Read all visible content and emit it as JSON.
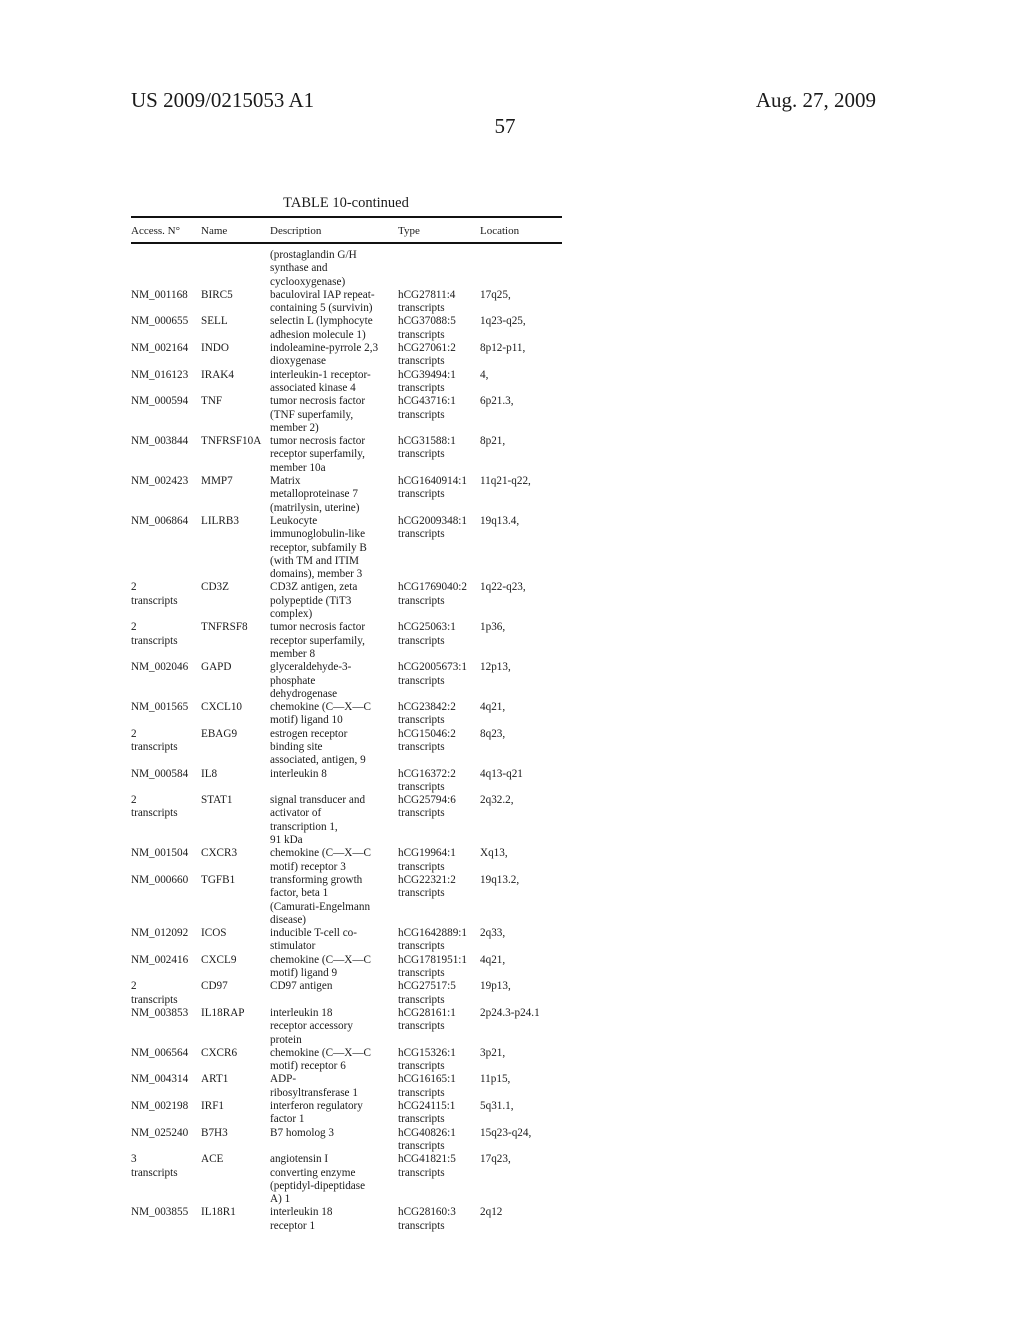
{
  "header": {
    "publication_number": "US 2009/0215053 A1",
    "date": "Aug. 27, 2009",
    "page_number": "57"
  },
  "table": {
    "title": "TABLE 10-continued",
    "columns": [
      "Access. N°",
      "Name",
      "Description",
      "Type",
      "Location"
    ],
    "rows": [
      {
        "access": [
          ""
        ],
        "name": [
          ""
        ],
        "description": [
          "(prostaglandin G/H",
          "synthase and",
          "cyclooxygenase)"
        ],
        "type": [
          ""
        ],
        "location": [
          ""
        ]
      },
      {
        "access": [
          "NM_001168"
        ],
        "name": [
          "BIRC5"
        ],
        "description": [
          "baculoviral IAP repeat-",
          "containing 5 (survivin)"
        ],
        "type": [
          "hCG27811:4",
          "transcripts"
        ],
        "location": [
          "17q25,"
        ]
      },
      {
        "access": [
          "NM_000655"
        ],
        "name": [
          "SELL"
        ],
        "description": [
          "selectin L (lymphocyte",
          "adhesion molecule 1)"
        ],
        "type": [
          "hCG37088:5",
          "transcripts"
        ],
        "location": [
          "1q23-q25,"
        ]
      },
      {
        "access": [
          "NM_002164"
        ],
        "name": [
          "INDO"
        ],
        "description": [
          "indoleamine-pyrrole 2,3",
          "dioxygenase"
        ],
        "type": [
          "hCG27061:2",
          "transcripts"
        ],
        "location": [
          "8p12-p11,"
        ]
      },
      {
        "access": [
          "NM_016123"
        ],
        "name": [
          "IRAK4"
        ],
        "description": [
          "interleukin-1 receptor-",
          "associated kinase 4"
        ],
        "type": [
          "hCG39494:1",
          "transcripts"
        ],
        "location": [
          "4,"
        ]
      },
      {
        "access": [
          "NM_000594"
        ],
        "name": [
          "TNF"
        ],
        "description": [
          "tumor necrosis factor",
          "(TNF superfamily,",
          "member 2)"
        ],
        "type": [
          "hCG43716:1",
          "transcripts"
        ],
        "location": [
          "6p21.3,"
        ]
      },
      {
        "access": [
          "NM_003844"
        ],
        "name": [
          "TNFRSF10A"
        ],
        "description": [
          "tumor necrosis factor",
          "receptor superfamily,",
          "member 10a"
        ],
        "type": [
          "hCG31588:1",
          "transcripts"
        ],
        "location": [
          "8p21,"
        ]
      },
      {
        "access": [
          "NM_002423"
        ],
        "name": [
          "MMP7"
        ],
        "description": [
          "Matrix",
          "metalloproteinase 7",
          "(matrilysin, uterine)"
        ],
        "type": [
          "hCG1640914:1",
          "transcripts"
        ],
        "location": [
          "11q21-q22,"
        ]
      },
      {
        "access": [
          "NM_006864"
        ],
        "name": [
          "LILRB3"
        ],
        "description": [
          "Leukocyte",
          "immunoglobulin-like",
          "receptor, subfamily B",
          "(with TM and ITIM",
          "domains), member 3"
        ],
        "type": [
          "hCG2009348:1",
          "transcripts"
        ],
        "location": [
          "19q13.4,"
        ]
      },
      {
        "access": [
          "2",
          "transcripts"
        ],
        "name": [
          "CD3Z"
        ],
        "description": [
          "CD3Z antigen, zeta",
          "polypeptide (TiT3",
          "complex)"
        ],
        "type": [
          "hCG1769040:2",
          "transcripts"
        ],
        "location": [
          "1q22-q23,"
        ]
      },
      {
        "access": [
          "2",
          "transcripts"
        ],
        "name": [
          "TNFRSF8"
        ],
        "description": [
          "tumor necrosis factor",
          "receptor superfamily,",
          "member 8"
        ],
        "type": [
          "hCG25063:1",
          "transcripts"
        ],
        "location": [
          "1p36,"
        ]
      },
      {
        "access": [
          "NM_002046"
        ],
        "name": [
          "GAPD"
        ],
        "description": [
          "glyceraldehyde-3-",
          "phosphate",
          "dehydrogenase"
        ],
        "type": [
          "hCG2005673:1",
          "transcripts"
        ],
        "location": [
          "12p13,"
        ]
      },
      {
        "access": [
          "NM_001565"
        ],
        "name": [
          "CXCL10"
        ],
        "description": [
          "chemokine (C—X—C",
          "motif) ligand 10"
        ],
        "type": [
          "hCG23842:2",
          "transcripts"
        ],
        "location": [
          "4q21,"
        ]
      },
      {
        "access": [
          "2",
          "transcripts"
        ],
        "name": [
          "EBAG9"
        ],
        "description": [
          "estrogen receptor",
          "binding site",
          "associated, antigen, 9"
        ],
        "type": [
          "hCG15046:2",
          "transcripts"
        ],
        "location": [
          "8q23,"
        ]
      },
      {
        "access": [
          "NM_000584"
        ],
        "name": [
          "IL8"
        ],
        "description": [
          "interleukin 8"
        ],
        "type": [
          "hCG16372:2",
          "transcripts"
        ],
        "location": [
          "4q13-q21"
        ]
      },
      {
        "access": [
          "2",
          "transcripts"
        ],
        "name": [
          "STAT1"
        ],
        "description": [
          "signal transducer and",
          "activator of",
          "transcription 1,",
          "91 kDa"
        ],
        "type": [
          "hCG25794:6",
          "transcripts"
        ],
        "location": [
          "2q32.2,"
        ]
      },
      {
        "access": [
          "NM_001504"
        ],
        "name": [
          "CXCR3"
        ],
        "description": [
          "chemokine (C—X—C",
          "motif) receptor 3"
        ],
        "type": [
          "hCG19964:1",
          "transcripts"
        ],
        "location": [
          "Xq13,"
        ]
      },
      {
        "access": [
          "NM_000660"
        ],
        "name": [
          "TGFB1"
        ],
        "description": [
          "transforming growth",
          "factor, beta 1",
          "(Camurati-Engelmann",
          "disease)"
        ],
        "type": [
          "hCG22321:2",
          "transcripts"
        ],
        "location": [
          "19q13.2,"
        ]
      },
      {
        "access": [
          "NM_012092"
        ],
        "name": [
          "ICOS"
        ],
        "description": [
          "inducible T-cell co-",
          "stimulator"
        ],
        "type": [
          "hCG1642889:1",
          "transcripts"
        ],
        "location": [
          "2q33,"
        ]
      },
      {
        "access": [
          "NM_002416"
        ],
        "name": [
          "CXCL9"
        ],
        "description": [
          "chemokine (C—X—C",
          "motif) ligand 9"
        ],
        "type": [
          "hCG1781951:1",
          "transcripts"
        ],
        "location": [
          "4q21,"
        ]
      },
      {
        "access": [
          "2",
          "transcripts"
        ],
        "name": [
          "CD97"
        ],
        "description": [
          "CD97 antigen"
        ],
        "type": [
          "hCG27517:5",
          "transcripts"
        ],
        "location": [
          "19p13,"
        ]
      },
      {
        "access": [
          "NM_003853"
        ],
        "name": [
          "IL18RAP"
        ],
        "description": [
          "interleukin 18",
          "receptor accessory",
          "protein"
        ],
        "type": [
          "hCG28161:1",
          "transcripts"
        ],
        "location": [
          "2p24.3-p24.1"
        ]
      },
      {
        "access": [
          "NM_006564"
        ],
        "name": [
          "CXCR6"
        ],
        "description": [
          "chemokine (C—X—C",
          "motif) receptor 6"
        ],
        "type": [
          "hCG15326:1",
          "transcripts"
        ],
        "location": [
          "3p21,"
        ]
      },
      {
        "access": [
          "NM_004314"
        ],
        "name": [
          "ART1"
        ],
        "description": [
          "ADP-",
          "ribosyltransferase 1"
        ],
        "type": [
          "hCG16165:1",
          "transcripts"
        ],
        "location": [
          "11p15,"
        ]
      },
      {
        "access": [
          "NM_002198"
        ],
        "name": [
          "IRF1"
        ],
        "description": [
          "interferon regulatory",
          "factor 1"
        ],
        "type": [
          "hCG24115:1",
          "transcripts"
        ],
        "location": [
          "5q31.1,"
        ]
      },
      {
        "access": [
          "NM_025240"
        ],
        "name": [
          "B7H3"
        ],
        "description": [
          "B7 homolog 3"
        ],
        "type": [
          "hCG40826:1",
          "transcripts"
        ],
        "location": [
          "15q23-q24,"
        ]
      },
      {
        "access": [
          "3",
          "transcripts"
        ],
        "name": [
          "ACE"
        ],
        "description": [
          "angiotensin I",
          "converting enzyme",
          "(peptidyl-dipeptidase",
          "A) 1"
        ],
        "type": [
          "hCG41821:5",
          "transcripts"
        ],
        "location": [
          "17q23,"
        ]
      },
      {
        "access": [
          "NM_003855"
        ],
        "name": [
          "IL18R1"
        ],
        "description": [
          "interleukin 18",
          "receptor 1"
        ],
        "type": [
          "hCG28160:3",
          "transcripts"
        ],
        "location": [
          "2q12"
        ]
      }
    ]
  }
}
